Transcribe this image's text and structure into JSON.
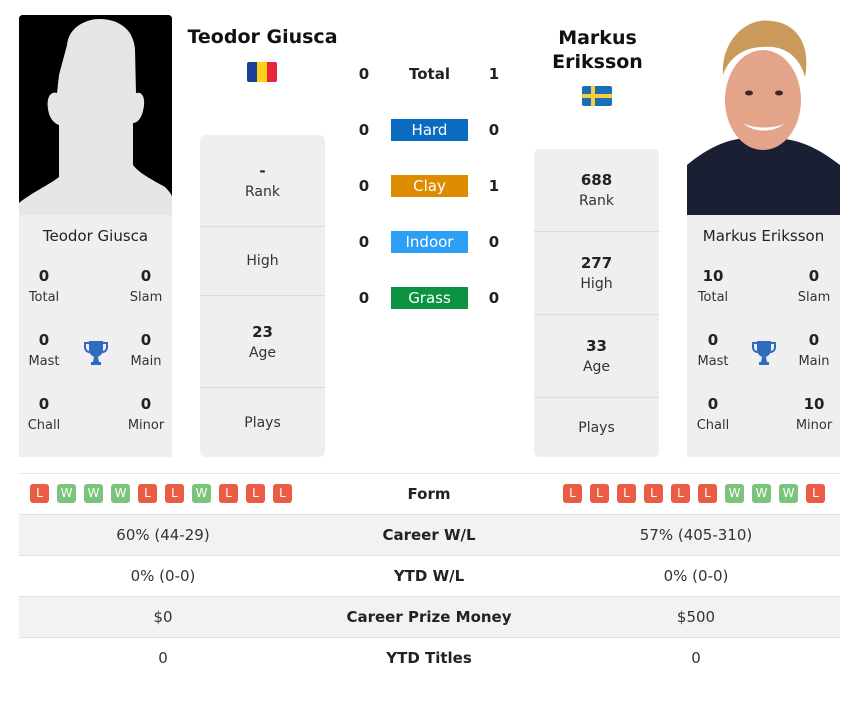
{
  "player_left": {
    "name": "Teodor Giusca",
    "country": "Romania",
    "flag_colors": [
      "#1d3f9a",
      "#fcd116",
      "#e8263c"
    ],
    "titles": {
      "total": "0",
      "total_label": "Total",
      "slam": "0",
      "slam_label": "Slam",
      "mast": "0",
      "mast_label": "Mast",
      "main": "0",
      "main_label": "Main",
      "chall": "0",
      "chall_label": "Chall",
      "minor": "0",
      "minor_label": "Minor"
    },
    "rank": {
      "value": "-",
      "label": "Rank"
    },
    "high": {
      "value": "",
      "label": "High"
    },
    "age": {
      "value": "23",
      "label": "Age"
    },
    "plays": {
      "value": "",
      "label": "Plays"
    },
    "form": [
      "L",
      "W",
      "W",
      "W",
      "L",
      "L",
      "W",
      "L",
      "L",
      "L"
    ]
  },
  "player_right": {
    "name": "Markus Eriksson",
    "country": "Sweden",
    "flag_colors": [
      "#1f6db5",
      "#f7cf3a"
    ],
    "titles": {
      "total": "10",
      "total_label": "Total",
      "slam": "0",
      "slam_label": "Slam",
      "mast": "0",
      "mast_label": "Mast",
      "main": "0",
      "main_label": "Main",
      "chall": "0",
      "chall_label": "Chall",
      "minor": "10",
      "minor_label": "Minor"
    },
    "rank": {
      "value": "688",
      "label": "Rank"
    },
    "high": {
      "value": "277",
      "label": "High"
    },
    "age": {
      "value": "33",
      "label": "Age"
    },
    "plays": {
      "value": "",
      "label": "Plays"
    },
    "form": [
      "L",
      "L",
      "L",
      "L",
      "L",
      "L",
      "W",
      "W",
      "W",
      "L"
    ]
  },
  "h2h": {
    "total": {
      "label": "Total",
      "left": "0",
      "right": "1"
    },
    "surfaces": [
      {
        "label": "Hard",
        "left": "0",
        "right": "0",
        "color": "#0a6bc1"
      },
      {
        "label": "Clay",
        "left": "0",
        "right": "1",
        "color": "#dd8c00"
      },
      {
        "label": "Indoor",
        "left": "0",
        "right": "0",
        "color": "#2d9ef5"
      },
      {
        "label": "Grass",
        "left": "0",
        "right": "0",
        "color": "#0b9341"
      }
    ]
  },
  "form_label": "Form",
  "comparison": [
    {
      "label": "Career W/L",
      "left": "60% (44-29)",
      "right": "57% (405-310)"
    },
    {
      "label": "YTD W/L",
      "left": "0% (0-0)",
      "right": "0% (0-0)"
    },
    {
      "label": "Career Prize Money",
      "left": "$0",
      "right": "$500"
    },
    {
      "label": "YTD Titles",
      "left": "0",
      "right": "0"
    }
  ],
  "icons": {
    "trophy": "trophy-icon",
    "silhouette": "player-silhouette-icon"
  }
}
